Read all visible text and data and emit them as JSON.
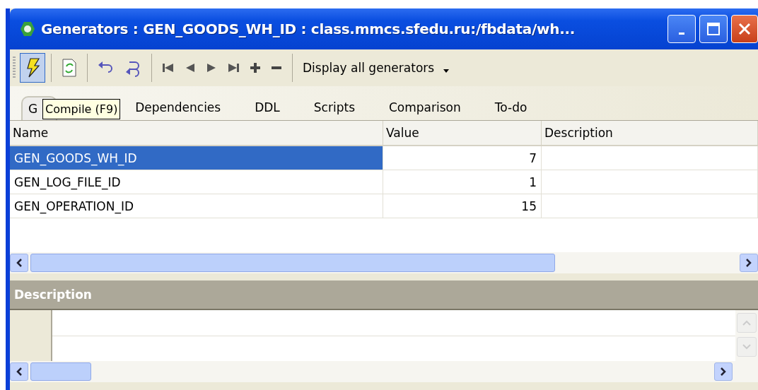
{
  "window": {
    "title": "Generators : GEN_GOODS_WH_ID : class.mmcs.sfedu.ru:/fbdata/wh..."
  },
  "toolbar": {
    "compile_pressed": true,
    "filter": "Display all generators"
  },
  "tooltip": {
    "text": "Compile (F9)"
  },
  "tabs": [
    {
      "label": "G",
      "selected": true
    },
    {
      "label": "Dependencies",
      "selected": false
    },
    {
      "label": "DDL",
      "selected": false
    },
    {
      "label": "Scripts",
      "selected": false
    },
    {
      "label": "Comparison",
      "selected": false
    },
    {
      "label": "To-do",
      "selected": false
    }
  ],
  "table": {
    "columns": [
      "Name",
      "Value",
      "Description"
    ],
    "rows": [
      {
        "name": "GEN_GOODS_WH_ID",
        "value": "7",
        "selected": true
      },
      {
        "name": "GEN_LOG_FILE_ID",
        "value": "1",
        "selected": false
      },
      {
        "name": "GEN_OPERATION_ID",
        "value": "15",
        "selected": false
      }
    ]
  },
  "description_panel": {
    "title": "Description"
  }
}
